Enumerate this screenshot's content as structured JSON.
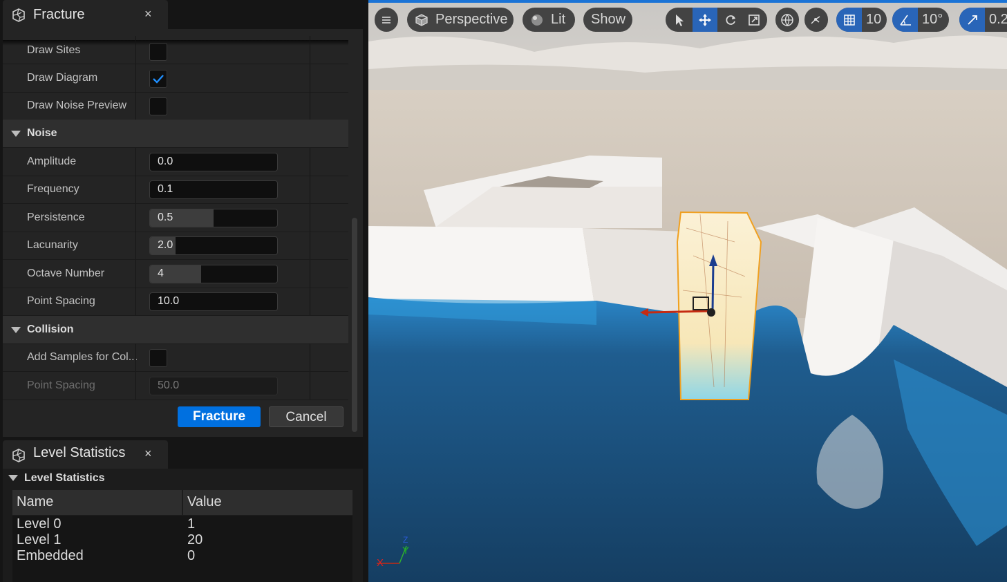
{
  "fracture_tab": {
    "title": "Fracture",
    "close": "×"
  },
  "properties": {
    "draw_sites": {
      "label": "Draw Sites",
      "checked": false
    },
    "draw_diagram": {
      "label": "Draw Diagram",
      "checked": true
    },
    "draw_noise_preview": {
      "label": "Draw Noise Preview",
      "checked": false
    },
    "noise_section": "Noise",
    "amplitude": {
      "label": "Amplitude",
      "value": "0.0"
    },
    "frequency": {
      "label": "Frequency",
      "value": "0.1"
    },
    "persistence": {
      "label": "Persistence",
      "value": "0.5",
      "slider_fraction": 0.5
    },
    "lacunarity": {
      "label": "Lacunarity",
      "value": "2.0",
      "slider_fraction": 0.2
    },
    "octave_number": {
      "label": "Octave Number",
      "value": "4",
      "slider_fraction": 0.4
    },
    "point_spacing": {
      "label": "Point Spacing",
      "value": "10.0"
    },
    "collision_section": "Collision",
    "add_samples": {
      "label": "Add Samples for Col...",
      "checked": false
    },
    "collision_point_spacing": {
      "label": "Point Spacing",
      "value": "50.0"
    }
  },
  "buttons": {
    "fracture": "Fracture",
    "cancel": "Cancel"
  },
  "level_stats_tab": {
    "title": "Level Statistics",
    "close": "×"
  },
  "level_stats": {
    "section": "Level Statistics",
    "columns": [
      "Name",
      "Value"
    ],
    "rows": [
      {
        "name": "Level 0",
        "value": "1"
      },
      {
        "name": "Level 1",
        "value": "20"
      },
      {
        "name": "Embedded",
        "value": "0"
      }
    ]
  },
  "viewport_toolbar": {
    "perspective": "Perspective",
    "lit": "Lit",
    "show": "Show",
    "grid_snap": "10",
    "rotation_snap": "10°",
    "scale_snap": "0.2"
  },
  "axis_gizmo": {
    "x": "X",
    "y": "Y",
    "z": "Z"
  },
  "colors": {
    "accent": "#0070e0",
    "panel": "#242424",
    "water": "#1d4f7a"
  }
}
